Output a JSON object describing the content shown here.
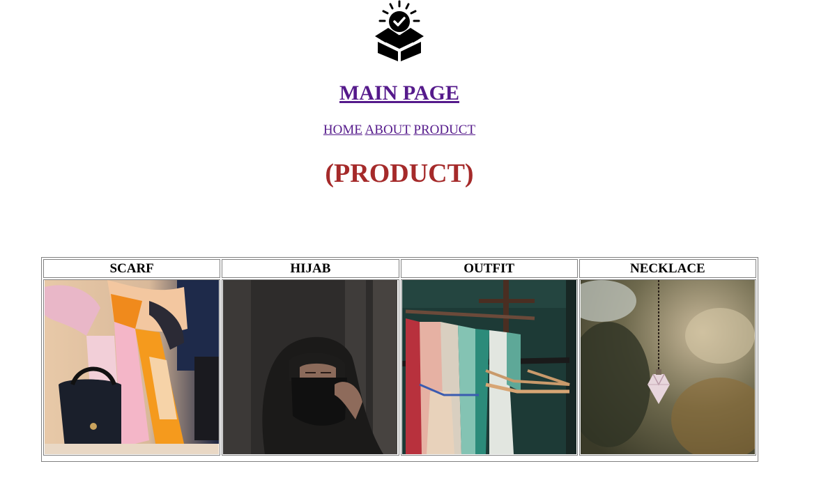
{
  "header": {
    "logo_icon": "box-check-icon",
    "main_title": "MAIN PAGE",
    "nav": {
      "home": "HOME",
      "about": "ABOUT",
      "product": "PRODUCT"
    },
    "section_title": "(PRODUCT)"
  },
  "products": {
    "columns": [
      {
        "label": "SCARF",
        "image": "scarf-photo"
      },
      {
        "label": "HIJAB",
        "image": "hijab-photo"
      },
      {
        "label": "OUTFIT",
        "image": "outfit-photo"
      },
      {
        "label": "NECKLACE",
        "image": "necklace-photo"
      }
    ]
  },
  "colors": {
    "link": "#551a8b",
    "section_title": "#a52a2a",
    "border": "#808080"
  }
}
